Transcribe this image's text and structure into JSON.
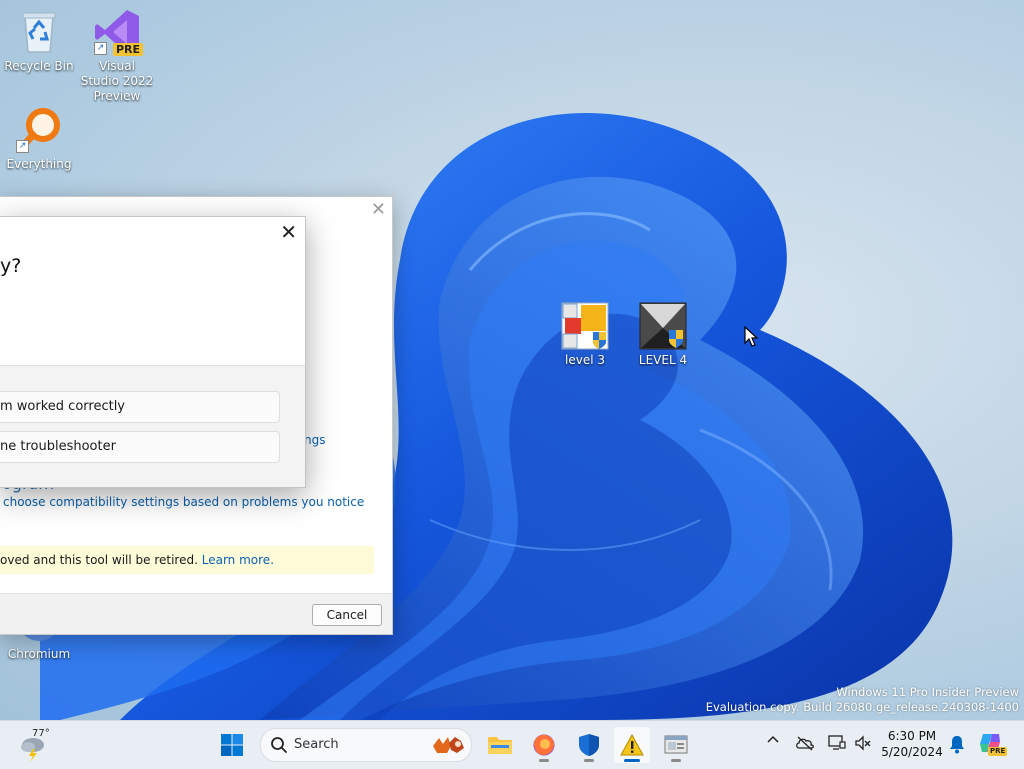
{
  "desktop": {
    "icons": [
      {
        "label": "Recycle Bin"
      },
      {
        "label": "Visual Studio 2022 Preview",
        "badge": "PRE"
      },
      {
        "label": "Everything"
      },
      {
        "label": "level 3"
      },
      {
        "label": "LEVEL 4"
      },
      {
        "label": "Chromium"
      }
    ],
    "watermark": {
      "line1": "Windows 11 Pro Insider Preview",
      "line2": "Evaluation copy. Build 26080.ge_release.240308-1400"
    }
  },
  "back_window": {
    "close_glyph": "✕",
    "link_settings_fragment": "ngs",
    "heading_fragment": "ogram",
    "link_choose": "choose compatibility settings based on problems you notice",
    "notice_text": "oved and this tool will be retired.",
    "notice_link": "Learn more.",
    "cancel_label": "Cancel"
  },
  "front_window": {
    "close_glyph": "✕",
    "question_fragment": "y?",
    "option1": "m worked correctly",
    "option2": "ne troubleshooter"
  },
  "taskbar": {
    "weather_temp": "77°",
    "search_label": "Search",
    "time": "6:30 PM",
    "date": "5/20/2024",
    "copilot_badge": "PRE"
  },
  "colors": {
    "accent": "#0067c0",
    "link": "#0b62b0",
    "notice_bg": "#fdfbd8",
    "bloom": "#1a63e0"
  }
}
